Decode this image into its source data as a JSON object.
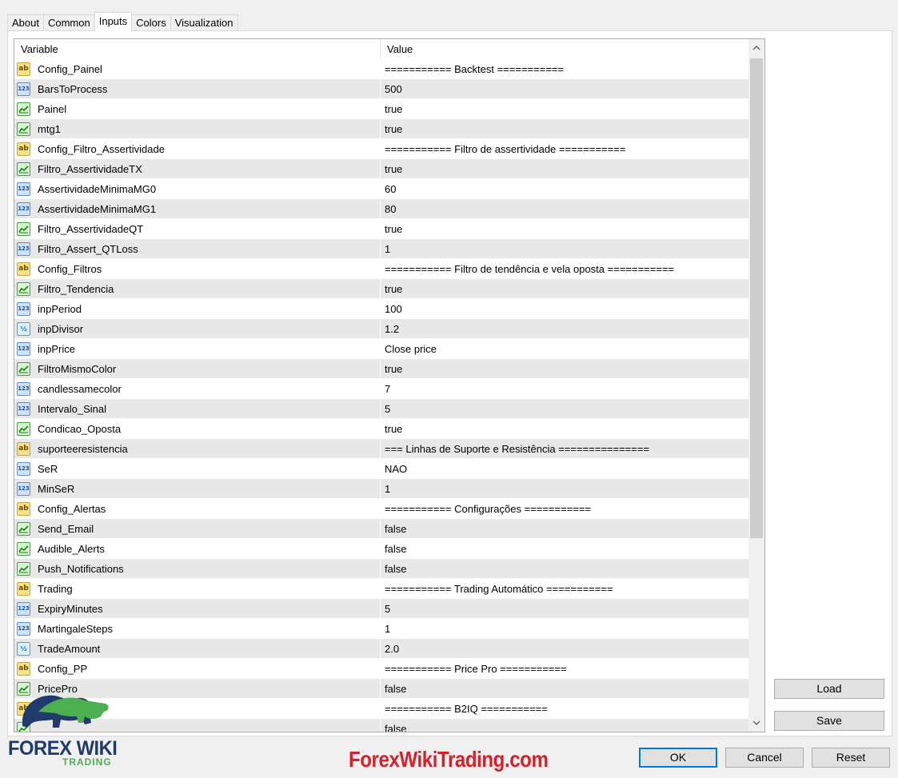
{
  "tabs": [
    {
      "label": "About"
    },
    {
      "label": "Common"
    },
    {
      "label": "Inputs"
    },
    {
      "label": "Colors"
    },
    {
      "label": "Visualization"
    }
  ],
  "active_tab": "Inputs",
  "table": {
    "headers": {
      "variable": "Variable",
      "value": "Value"
    },
    "rows": [
      {
        "type": "string-icon",
        "variable": "Config_Painel",
        "value": "=========== Backtest ==========="
      },
      {
        "type": "int-icon",
        "variable": "BarsToProcess",
        "value": "500"
      },
      {
        "type": "bool-icon",
        "variable": "Painel",
        "value": "true"
      },
      {
        "type": "bool-icon",
        "variable": "mtg1",
        "value": "true"
      },
      {
        "type": "string-icon",
        "variable": "Config_Filtro_Assertividade",
        "value": "=========== Filtro de assertividade ==========="
      },
      {
        "type": "bool-icon",
        "variable": "Filtro_AssertividadeTX",
        "value": "true"
      },
      {
        "type": "int-icon",
        "variable": "AssertividadeMinimaMG0",
        "value": "60"
      },
      {
        "type": "int-icon",
        "variable": "AssertividadeMinimaMG1",
        "value": "80"
      },
      {
        "type": "bool-icon",
        "variable": "Filtro_AssertividadeQT",
        "value": "true"
      },
      {
        "type": "int-icon",
        "variable": "Filtro_Assert_QTLoss",
        "value": "1"
      },
      {
        "type": "string-icon",
        "variable": "Config_Filtros",
        "value": "=========== Filtro de tendência e vela oposta ==========="
      },
      {
        "type": "bool-icon",
        "variable": "Filtro_Tendencia",
        "value": "true"
      },
      {
        "type": "int-icon",
        "variable": "inpPeriod",
        "value": "100"
      },
      {
        "type": "double-icon",
        "variable": "inpDivisor",
        "value": "1.2"
      },
      {
        "type": "int-icon",
        "variable": "inpPrice",
        "value": "Close price"
      },
      {
        "type": "bool-icon",
        "variable": "FiltroMismoColor",
        "value": "true"
      },
      {
        "type": "int-icon",
        "variable": "candlessamecolor",
        "value": "7"
      },
      {
        "type": "int-icon",
        "variable": "Intervalo_Sinal",
        "value": "5"
      },
      {
        "type": "bool-icon",
        "variable": "Condicao_Oposta",
        "value": "true"
      },
      {
        "type": "string-icon",
        "variable": "suporteeresistencia",
        "value": "=== Linhas de Suporte e Resistência ==============="
      },
      {
        "type": "int-icon",
        "variable": "SeR",
        "value": "NAO"
      },
      {
        "type": "int-icon",
        "variable": "MinSeR",
        "value": "1"
      },
      {
        "type": "string-icon",
        "variable": "Config_Alertas",
        "value": "=========== Configurações ==========="
      },
      {
        "type": "bool-icon",
        "variable": "Send_Email",
        "value": "false"
      },
      {
        "type": "bool-icon",
        "variable": "Audible_Alerts",
        "value": "false"
      },
      {
        "type": "bool-icon",
        "variable": "Push_Notifications",
        "value": "false"
      },
      {
        "type": "string-icon",
        "variable": "Trading",
        "value": "=========== Trading Automático ==========="
      },
      {
        "type": "int-icon",
        "variable": "ExpiryMinutes",
        "value": "5"
      },
      {
        "type": "int-icon",
        "variable": "MartingaleSteps",
        "value": "1"
      },
      {
        "type": "double-icon",
        "variable": "TradeAmount",
        "value": "2.0"
      },
      {
        "type": "string-icon",
        "variable": "Config_PP",
        "value": "=========== Price Pro ==========="
      },
      {
        "type": "bool-icon",
        "variable": "PricePro",
        "value": "false"
      },
      {
        "type": "string-icon",
        "variable": "",
        "value": "=========== B2IQ ==========="
      },
      {
        "type": "bool-icon",
        "variable": "",
        "value": "false"
      }
    ]
  },
  "side_buttons": {
    "load": "Load",
    "save": "Save"
  },
  "footer_buttons": {
    "ok": "OK",
    "cancel": "Cancel",
    "reset": "Reset"
  },
  "logo": {
    "line1": "FOREX WIKI",
    "line2": "TRADING"
  },
  "watermark": "ForexWikiTrading.com",
  "colors": {
    "row_alt": "#e8e8e8",
    "button_face": "#e1e1e1",
    "default_button_border": "#0078d7",
    "watermark": "#d6202a",
    "logo_navy": "#1f3a6b",
    "logo_green": "#4caf50"
  }
}
